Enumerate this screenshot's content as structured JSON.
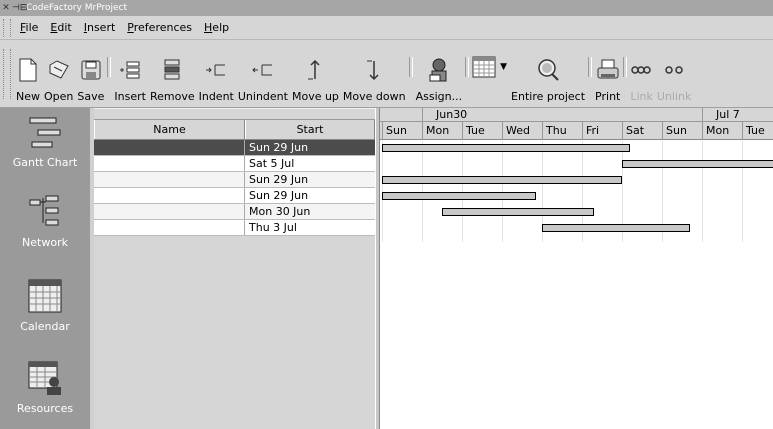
{
  "window": {
    "title": "CodeFactory MrProject"
  },
  "menu": [
    {
      "label": "File",
      "u": "F",
      "rest": "ile"
    },
    {
      "label": "Edit",
      "u": "E",
      "rest": "dit"
    },
    {
      "label": "Insert",
      "u": "I",
      "rest": "nsert"
    },
    {
      "label": "Preferences",
      "u": "P",
      "rest": "references"
    },
    {
      "label": "Help",
      "u": "H",
      "rest": "elp"
    }
  ],
  "toolbar": {
    "new": "New",
    "open": "Open",
    "save": "Save",
    "insert": "Insert",
    "remove": "Remove",
    "indent": "Indent",
    "unindent": "Unindent",
    "move_up": "Move up",
    "move_down": "Move down",
    "assign": "Assign...",
    "entire_project": "Entire project",
    "print": "Print",
    "link": "Link",
    "unlink": "Unlink"
  },
  "sidebar": [
    {
      "label": "Gantt Chart",
      "icon": "gantt-icon"
    },
    {
      "label": "Network",
      "icon": "network-icon"
    },
    {
      "label": "Calendar",
      "icon": "calendar-icon"
    },
    {
      "label": "Resources",
      "icon": "resources-icon"
    }
  ],
  "table": {
    "columns": {
      "name": "Name",
      "start": "Start"
    },
    "rows": [
      {
        "name": "",
        "start": "Sun 29 Jun",
        "selected": true
      },
      {
        "name": "",
        "start": "Sat  5 Jul"
      },
      {
        "name": "",
        "start": "Sun 29 Jun"
      },
      {
        "name": "",
        "start": "Sun 29 Jun"
      },
      {
        "name": "",
        "start": "Mon 30 Jun"
      },
      {
        "name": "",
        "start": "Thu  3 Jul"
      }
    ]
  },
  "gantt": {
    "weeks": [
      {
        "label": "Jun30"
      },
      {
        "label": "Jul 7"
      }
    ],
    "days": [
      "Sun",
      "Mon",
      "Tue",
      "Wed",
      "Thu",
      "Fri",
      "Sat",
      "Sun",
      "Mon",
      "Tue"
    ],
    "tasks": [
      {
        "start": 0,
        "end": 6.2
      },
      {
        "start": 6,
        "end": 10
      },
      {
        "start": 0,
        "end": 6
      },
      {
        "start": 0,
        "end": 3.85
      },
      {
        "start": 1.5,
        "end": 5.3
      },
      {
        "start": 4,
        "end": 7.7
      }
    ]
  }
}
